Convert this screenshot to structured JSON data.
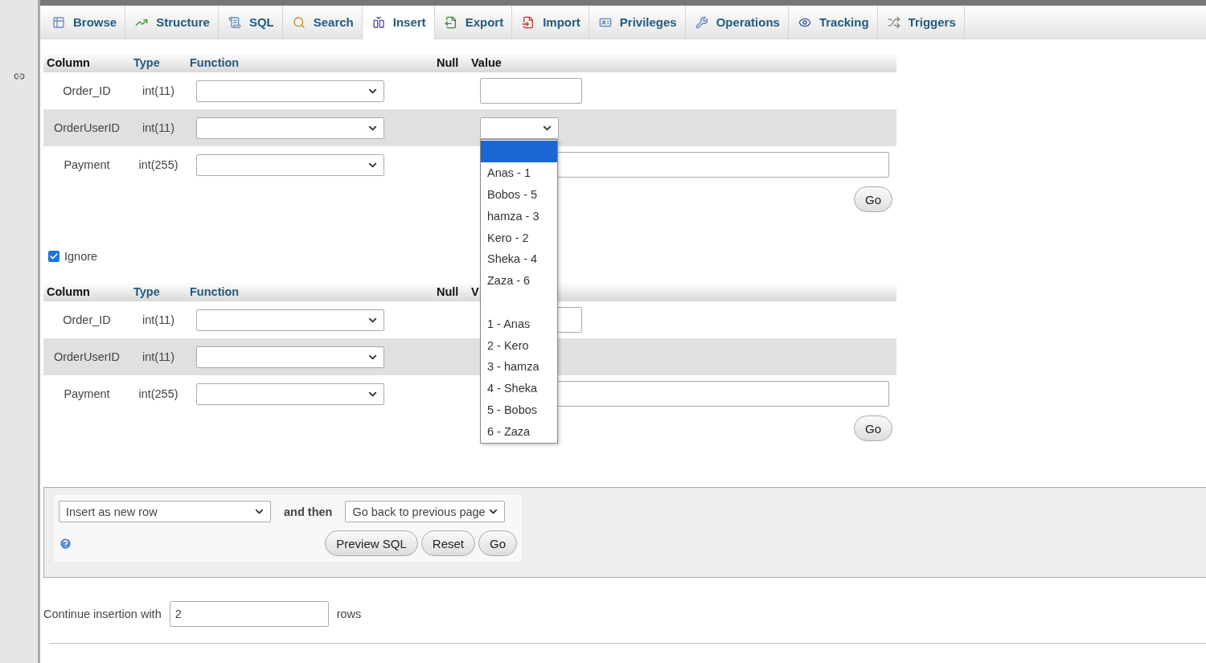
{
  "tabs": [
    {
      "label": "Browse",
      "selected": false
    },
    {
      "label": "Structure",
      "selected": false
    },
    {
      "label": "SQL",
      "selected": false
    },
    {
      "label": "Search",
      "selected": false
    },
    {
      "label": "Insert",
      "selected": true
    },
    {
      "label": "Export",
      "selected": false
    },
    {
      "label": "Import",
      "selected": false
    },
    {
      "label": "Privileges",
      "selected": false
    },
    {
      "label": "Operations",
      "selected": false
    },
    {
      "label": "Tracking",
      "selected": false
    },
    {
      "label": "Triggers",
      "selected": false
    }
  ],
  "forms": [
    {
      "headers": {
        "column": "Column",
        "type": "Type",
        "function": "Function",
        "null": "Null",
        "value": "Value"
      },
      "rows": [
        {
          "column": "Order_ID",
          "type": "int(11)",
          "kind": "input"
        },
        {
          "column": "OrderUserID",
          "type": "int(11)",
          "kind": "select",
          "expanded": true,
          "options": [
            {
              "kind": "blank",
              "selected": true
            },
            {
              "kind": "option",
              "label": "Anas - 1",
              "selected": false
            },
            {
              "kind": "option",
              "label": "Bobos - 5",
              "selected": false
            },
            {
              "kind": "option",
              "label": "hamza - 3",
              "selected": false
            },
            {
              "kind": "option",
              "label": "Kero - 2",
              "selected": false
            },
            {
              "kind": "option",
              "label": "Sheka - 4",
              "selected": false
            },
            {
              "kind": "option",
              "label": "Zaza - 6",
              "selected": false
            },
            {
              "kind": "blank",
              "selected": false
            },
            {
              "kind": "option",
              "label": "1 - Anas",
              "selected": false
            },
            {
              "kind": "option",
              "label": "2 - Kero",
              "selected": false
            },
            {
              "kind": "option",
              "label": "3 - hamza",
              "selected": false
            },
            {
              "kind": "option",
              "label": "4 - Sheka",
              "selected": false
            },
            {
              "kind": "option",
              "label": "5 - Bobos",
              "selected": false
            },
            {
              "kind": "option",
              "label": "6 - Zaza",
              "selected": false
            }
          ]
        },
        {
          "column": "Payment",
          "type": "int(255)",
          "kind": "wide_input"
        }
      ],
      "go": "Go"
    },
    {
      "headers": {
        "column": "Column",
        "type": "Type",
        "function": "Function",
        "null": "Null",
        "value": "V"
      },
      "rows": [
        {
          "column": "Order_ID",
          "type": "int(11)",
          "kind": "input"
        },
        {
          "column": "OrderUserID",
          "type": "int(11)"
        },
        {
          "column": "Payment",
          "type": "int(255)",
          "kind": "wide_input"
        }
      ],
      "go": "Go"
    }
  ],
  "ignore": {
    "label": "Ignore",
    "checked": true
  },
  "actions": {
    "insert_mode": "Insert as new row",
    "and_then": "and then",
    "after": "Go back to previous page",
    "buttons": [
      "Preview SQL",
      "Reset",
      "Go"
    ]
  },
  "continue": {
    "label": "Continue insertion with",
    "value": "2",
    "suffix": "rows"
  }
}
